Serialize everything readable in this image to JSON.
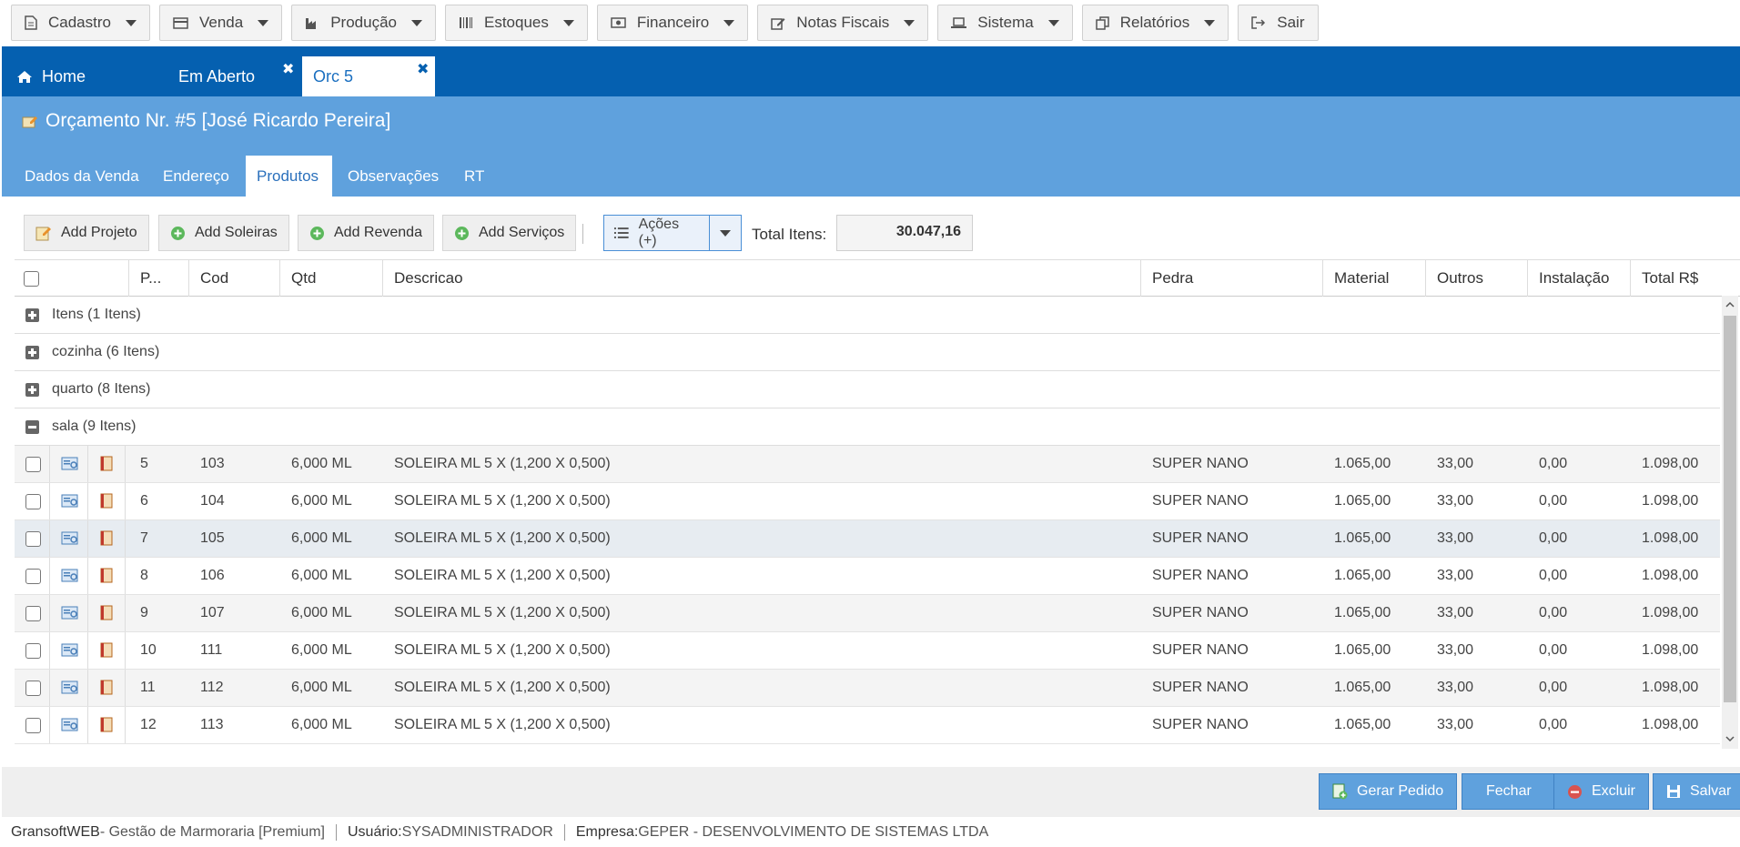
{
  "menu": {
    "items": [
      {
        "label": "Cadastro",
        "icon": "file-icon"
      },
      {
        "label": "Venda",
        "icon": "card-icon"
      },
      {
        "label": "Produção",
        "icon": "factory-icon"
      },
      {
        "label": "Estoques",
        "icon": "barcode-icon"
      },
      {
        "label": "Financeiro",
        "icon": "money-icon"
      },
      {
        "label": "Notas Fiscais",
        "icon": "edit-icon"
      },
      {
        "label": "Sistema",
        "icon": "laptop-icon"
      },
      {
        "label": "Relatórios",
        "icon": "copy-icon"
      }
    ],
    "exit_label": "Sair"
  },
  "doc_tabs": {
    "home": "Home",
    "em_aberto": "Em Aberto",
    "orc": "Orc 5",
    "close_symbol": "✖"
  },
  "header": {
    "title": "Orçamento Nr. #5 [José Ricardo Pereira]"
  },
  "sub_tabs": [
    "Dados da Venda",
    "Endereço",
    "Produtos",
    "Observações",
    "RT"
  ],
  "toolbar": {
    "add_projeto": "Add Projeto",
    "add_soleiras": "Add Soleiras",
    "add_revenda": "Add Revenda",
    "add_servicos": "Add Serviços",
    "acoes": "Ações (+)",
    "total_label": "Total Itens:",
    "total_value": "30.047,16"
  },
  "grid": {
    "columns": [
      "P...",
      "Cod",
      "Qtd",
      "Descricao",
      "Pedra",
      "Material",
      "Outros",
      "Instalação",
      "Total R$"
    ],
    "groups": [
      {
        "label": "Itens (1 Itens)",
        "expanded": false
      },
      {
        "label": "cozinha (6 Itens)",
        "expanded": false
      },
      {
        "label": "quarto (8 Itens)",
        "expanded": false
      },
      {
        "label": "sala (9 Itens)",
        "expanded": true
      }
    ],
    "rows": [
      {
        "p": "5",
        "cod": "103",
        "qtd": "6,000 ML",
        "desc": "SOLEIRA ML 5 X (1,200 X 0,500)",
        "pedra": "SUPER NANO",
        "material": "1.065,00",
        "outros": "33,00",
        "instalacao": "0,00",
        "total": "1.098,00"
      },
      {
        "p": "6",
        "cod": "104",
        "qtd": "6,000 ML",
        "desc": "SOLEIRA ML 5 X (1,200 X 0,500)",
        "pedra": "SUPER NANO",
        "material": "1.065,00",
        "outros": "33,00",
        "instalacao": "0,00",
        "total": "1.098,00"
      },
      {
        "p": "7",
        "cod": "105",
        "qtd": "6,000 ML",
        "desc": "SOLEIRA ML 5 X (1,200 X 0,500)",
        "pedra": "SUPER NANO",
        "material": "1.065,00",
        "outros": "33,00",
        "instalacao": "0,00",
        "total": "1.098,00"
      },
      {
        "p": "8",
        "cod": "106",
        "qtd": "6,000 ML",
        "desc": "SOLEIRA ML 5 X (1,200 X 0,500)",
        "pedra": "SUPER NANO",
        "material": "1.065,00",
        "outros": "33,00",
        "instalacao": "0,00",
        "total": "1.098,00"
      },
      {
        "p": "9",
        "cod": "107",
        "qtd": "6,000 ML",
        "desc": "SOLEIRA ML 5 X (1,200 X 0,500)",
        "pedra": "SUPER NANO",
        "material": "1.065,00",
        "outros": "33,00",
        "instalacao": "0,00",
        "total": "1.098,00"
      },
      {
        "p": "10",
        "cod": "111",
        "qtd": "6,000 ML",
        "desc": "SOLEIRA ML 5 X (1,200 X 0,500)",
        "pedra": "SUPER NANO",
        "material": "1.065,00",
        "outros": "33,00",
        "instalacao": "0,00",
        "total": "1.098,00"
      },
      {
        "p": "11",
        "cod": "112",
        "qtd": "6,000 ML",
        "desc": "SOLEIRA ML 5 X (1,200 X 0,500)",
        "pedra": "SUPER NANO",
        "material": "1.065,00",
        "outros": "33,00",
        "instalacao": "0,00",
        "total": "1.098,00"
      },
      {
        "p": "12",
        "cod": "113",
        "qtd": "6,000 ML",
        "desc": "SOLEIRA ML 5 X (1,200 X 0,500)",
        "pedra": "SUPER NANO",
        "material": "1.065,00",
        "outros": "33,00",
        "instalacao": "0,00",
        "total": "1.098,00"
      }
    ]
  },
  "footer": {
    "gerar_pedido": "Gerar Pedido",
    "fechar": "Fechar",
    "excluir": "Excluir",
    "salvar": "Salvar"
  },
  "status": {
    "app": "GransoftWEB",
    "app_desc": " - Gestão de Marmoraria [Premium]",
    "user_label": "Usuário:",
    "user": "SYSADMINISTRADOR",
    "company_label": "Empresa:",
    "company": "GEPER - DESENVOLVIMENTO DE SISTEMAS LTDA"
  },
  "colors": {
    "tab_bar": "#0560b0",
    "header": "#5fa1dd",
    "button_primary": "#5fa1dd"
  }
}
